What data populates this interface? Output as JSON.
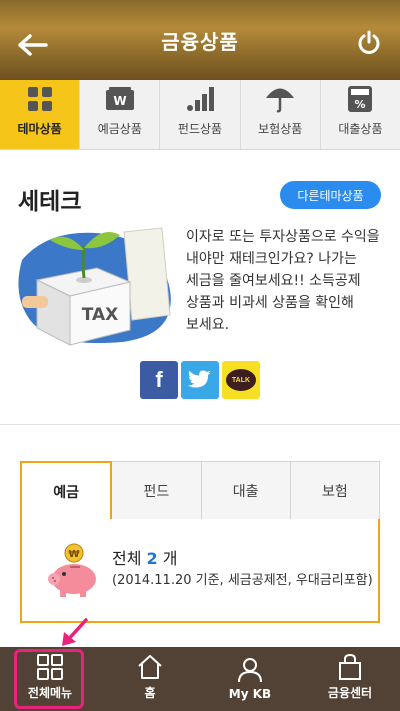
{
  "header": {
    "title": "금융상품"
  },
  "category_tabs": [
    {
      "label": "테마상품",
      "icon": "grid-icon",
      "active": true
    },
    {
      "label": "예금상품",
      "icon": "won-wallet-icon",
      "active": false
    },
    {
      "label": "펀드상품",
      "icon": "bar-chart-icon",
      "active": false
    },
    {
      "label": "보험상품",
      "icon": "umbrella-icon",
      "active": false
    },
    {
      "label": "대출상품",
      "icon": "percent-calculator-icon",
      "active": false
    }
  ],
  "section": {
    "title": "세테크",
    "other_button": "다른테마상품",
    "description": "이자로 또는 투자상품으로 수익을 내야만 재테크인가요? 나가는 세금을 줄여보세요!! 소득공제 상품과 비과세 상품을 확인해 보세요.",
    "illustration_text": "TAX"
  },
  "share": {
    "facebook": "f",
    "kakao": "TALK"
  },
  "product_tabs": [
    "예금",
    "펀드",
    "대출",
    "보험"
  ],
  "product_box": {
    "total_prefix": "전체",
    "count": "2",
    "total_suffix": "개",
    "note": "(2014.11.20 기준, 세금공제전, 우대금리포함)",
    "coin": "₩"
  },
  "bottom_nav": [
    {
      "label": "전체메뉴",
      "icon": "menu-grid-icon"
    },
    {
      "label": "홈",
      "icon": "home-icon"
    },
    {
      "label": "My KB",
      "icon": "person-icon"
    },
    {
      "label": "금융센터",
      "icon": "bag-icon"
    }
  ],
  "colors": {
    "accent": "#f6c51a",
    "brand_brown": "#524235",
    "blue_button": "#2b8cf0",
    "tab_border": "#f0a21a",
    "highlight": "#e8237c"
  }
}
